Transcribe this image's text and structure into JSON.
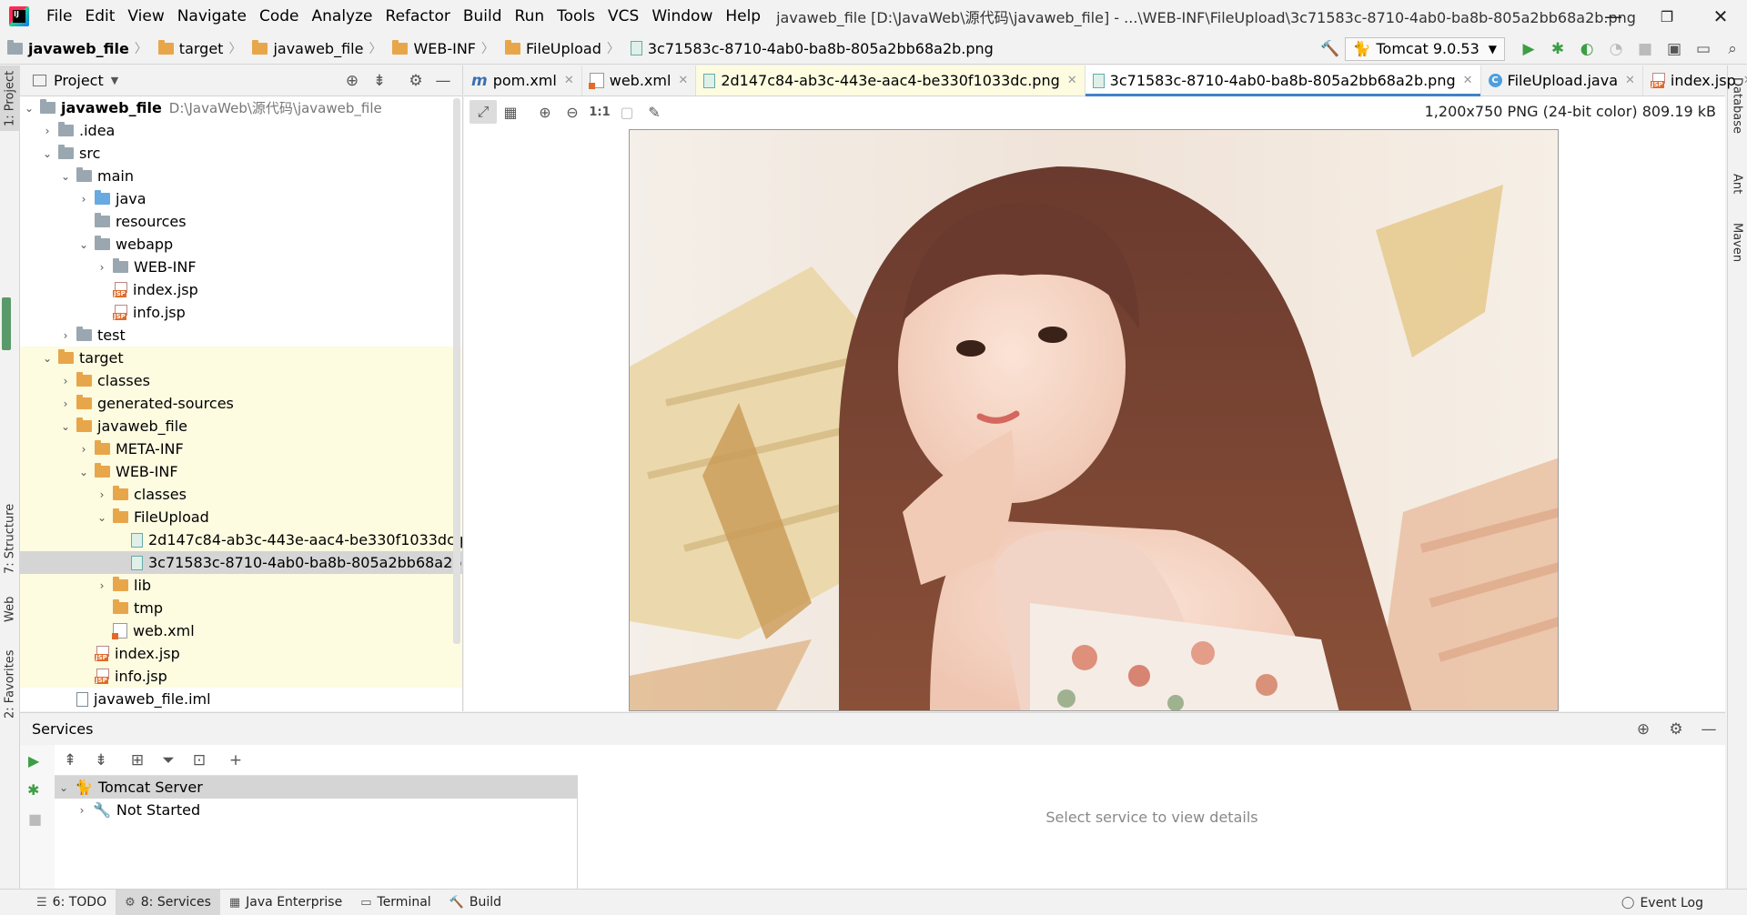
{
  "menu": [
    "File",
    "Edit",
    "View",
    "Navigate",
    "Code",
    "Analyze",
    "Refactor",
    "Build",
    "Run",
    "Tools",
    "VCS",
    "Window",
    "Help"
  ],
  "window_title": "javaweb_file [D:\\JavaWeb\\源代码\\javaweb_file] - ...\\WEB-INF\\FileUpload\\3c71583c-8710-4ab0-ba8b-805a2bb68a2b.png",
  "window_controls": {
    "minimize": "—",
    "restore": "❐",
    "close": "✕"
  },
  "breadcrumbs": [
    "javaweb_file",
    "target",
    "javaweb_file",
    "WEB-INF",
    "FileUpload",
    "3c71583c-8710-4ab0-ba8b-805a2bb68a2b.png"
  ],
  "run_config": {
    "label": "Tomcat 9.0.53"
  },
  "left_strip": {
    "project": "1: Project",
    "structure": "7: Structure",
    "web": "Web",
    "favorites": "2: Favorites"
  },
  "right_strip": {
    "database": "Database",
    "ant": "Ant",
    "maven": "Maven"
  },
  "project_panel": {
    "title": "Project",
    "root_name": "javaweb_file",
    "root_path": "D:\\JavaWeb\\源代码\\javaweb_file",
    "items": [
      ".idea",
      "src",
      "main",
      "java",
      "resources",
      "webapp",
      "WEB-INF",
      "index.jsp",
      "info.jsp",
      "test",
      "target",
      "classes",
      "generated-sources",
      "javaweb_file",
      "META-INF",
      "WEB-INF",
      "classes",
      "FileUpload",
      "2d147c84-ab3c-443e-aac4-be330f1033dc.png",
      "3c71583c-8710-4ab0-ba8b-805a2bb68a2b.png",
      "lib",
      "tmp",
      "web.xml",
      "index.jsp",
      "info.jsp",
      "javaweb_file.iml"
    ]
  },
  "tabs": [
    "pom.xml",
    "web.xml",
    "2d147c84-ab3c-443e-aac4-be330f1033dc.png",
    "3c71583c-8710-4ab0-ba8b-805a2bb68a2b.png",
    "FileUpload.java",
    "index.jsp"
  ],
  "image_viewer": {
    "info": "1,200x750 PNG (24-bit color) 809.19 kB",
    "actual_size": "1:1"
  },
  "services": {
    "title": "Services",
    "tomcat_server": "Tomcat Server",
    "not_started": "Not Started",
    "detail_placeholder": "Select service to view details"
  },
  "statusbar": {
    "todo": "6: TODO",
    "services": "8: Services",
    "java_enterprise": "Java Enterprise",
    "terminal": "Terminal",
    "build": "Build",
    "event_log": "Event Log"
  },
  "colors": {
    "accent": "#4083c9",
    "folder": "#e8a64b",
    "run_green": "#3c9e45",
    "changed_bg": "#fdfbe0",
    "selection": "#d5d5d5"
  }
}
